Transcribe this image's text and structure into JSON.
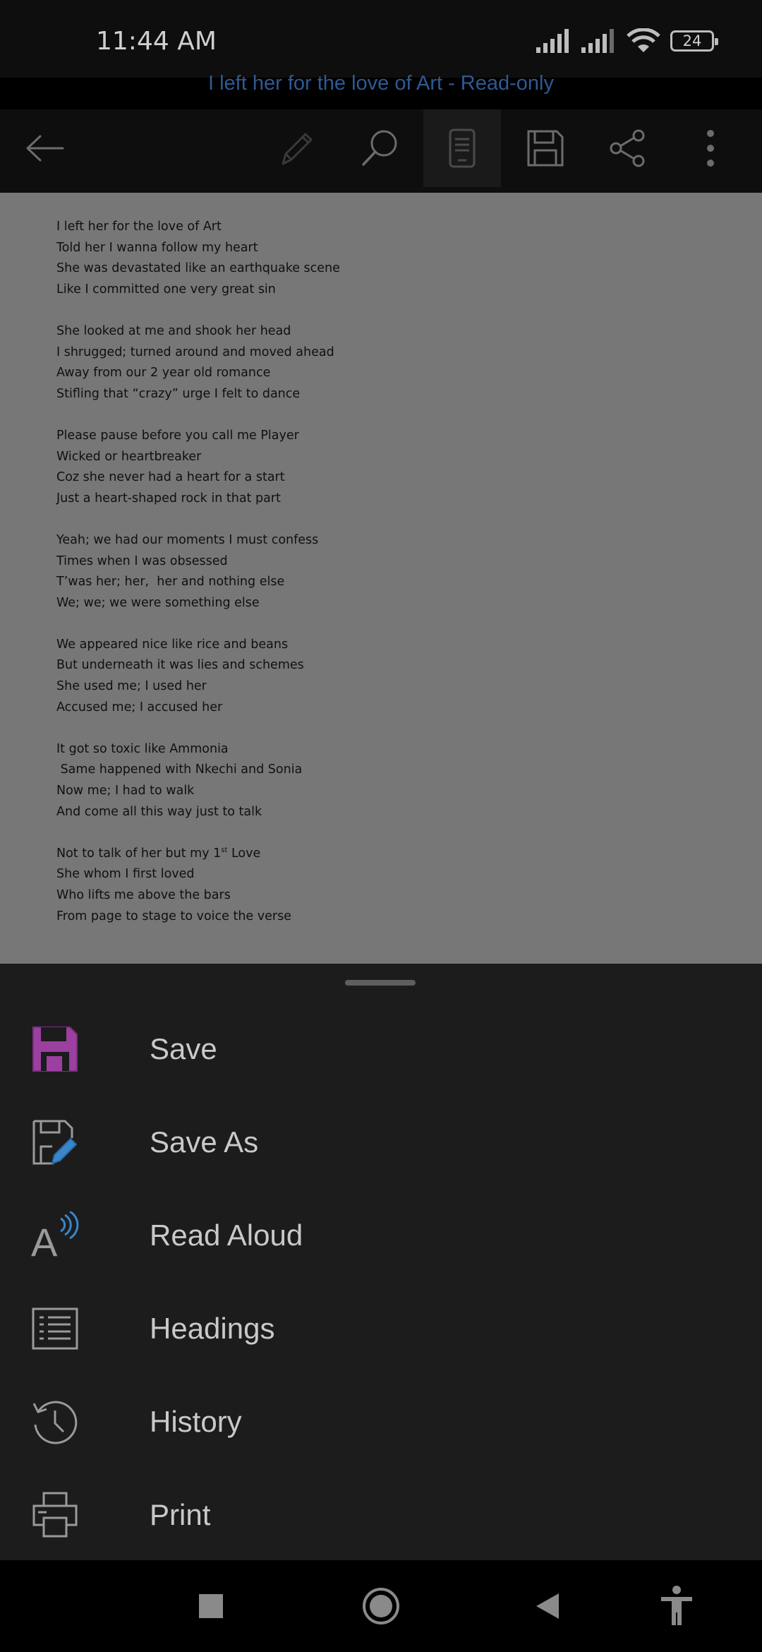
{
  "status_bar": {
    "time": "11:44 AM",
    "battery": "24",
    "icons": [
      "signal-icon",
      "signal-icon",
      "wifi-icon",
      "battery-icon"
    ]
  },
  "document": {
    "title": "I left her for the love of Art - Read-only",
    "stanzas": [
      [
        "I left her for the love of Art",
        "Told her I wanna follow my heart",
        "She was devastated like an earthquake scene",
        "Like I committed one very great sin"
      ],
      [
        "She looked at me and shook her head",
        "I shrugged; turned around and moved ahead",
        "Away from our 2 year old romance",
        "Stifling that “crazy” urge I felt to dance"
      ],
      [
        "Please pause before you call me Player",
        "Wicked or heartbreaker",
        "Coz she never had a heart for a start",
        "Just a heart-shaped rock in that part"
      ],
      [
        "Yeah; we had our moments I must confess",
        "Times when I was obsessed",
        "T’was her; her,  her and nothing else",
        "We; we; we were something else"
      ],
      [
        "We appeared nice like rice and beans",
        "But underneath it was lies and schemes",
        "She used me; I used her",
        "Accused me; I accused her"
      ],
      [
        "It got so toxic like Ammonia",
        " Same happened with Nkechi and Sonia",
        "Now me; I had to walk",
        "And come all this way just to talk"
      ]
    ],
    "last_stanza": {
      "line1_before": "Not to talk of her but my 1",
      "line1_sup": "st",
      "line1_after": " Love",
      "lines": [
        "She whom I first loved",
        "Who lifts me above the bars",
        "From page to stage to voice the verse"
      ]
    }
  },
  "toolbar": {
    "icons": [
      "back-arrow-icon",
      "edit-pencil-icon",
      "search-icon",
      "reading-view-icon",
      "save-icon",
      "share-icon",
      "more-options-icon"
    ]
  },
  "menu": {
    "items": [
      {
        "label": "Save",
        "icon": "save-icon"
      },
      {
        "label": "Save As",
        "icon": "save-as-icon"
      },
      {
        "label": "Read Aloud",
        "icon": "read-aloud-icon"
      },
      {
        "label": "Headings",
        "icon": "headings-icon"
      },
      {
        "label": "History",
        "icon": "history-icon"
      },
      {
        "label": "Print",
        "icon": "print-icon"
      }
    ]
  },
  "nav": {
    "icons": [
      "recents-square-icon",
      "home-circle-icon",
      "back-triangle-icon",
      "accessibility-icon"
    ]
  },
  "colors": {
    "title": "#2e5a92",
    "save_icon": "#9b3fa0",
    "save_as_pencil": "#3a86c8",
    "read_aloud_waves": "#3a86c8"
  }
}
